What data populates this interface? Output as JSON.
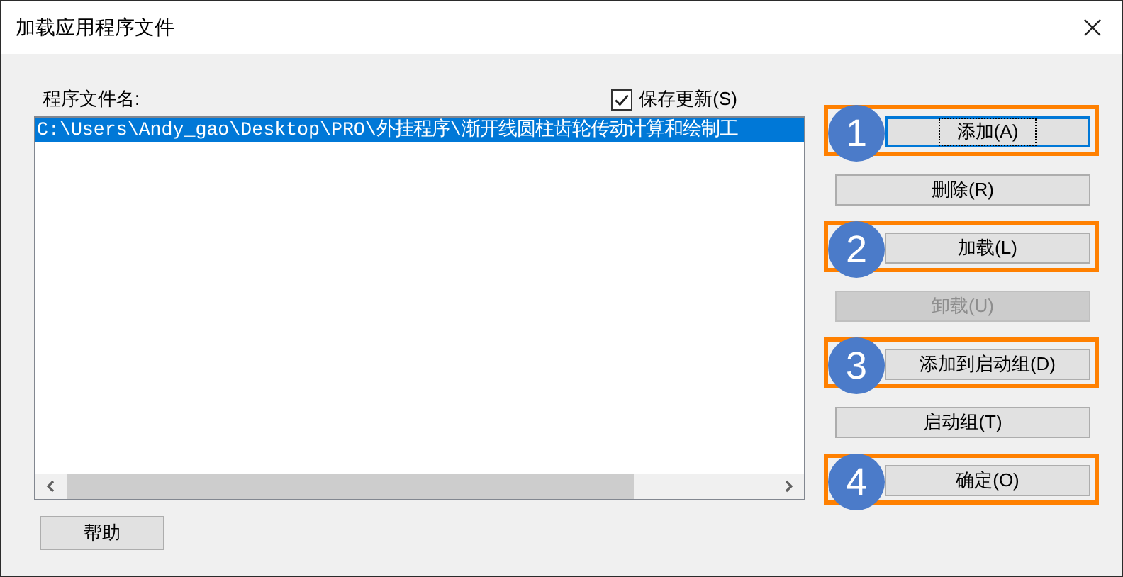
{
  "window": {
    "title": "加载应用程序文件"
  },
  "file_list": {
    "label": "程序文件名:",
    "items": [
      {
        "text": "C:\\Users\\Andy_gao\\Desktop\\PRO\\外挂程序\\渐开线圆柱齿轮传动计算和绘制工",
        "selected": true
      }
    ]
  },
  "save_updates": {
    "label": "保存更新(S)",
    "checked": true
  },
  "buttons": [
    {
      "label": "添加(A)",
      "disabled": false,
      "focused": true,
      "step": "1"
    },
    {
      "label": "删除(R)",
      "disabled": false,
      "focused": false
    },
    {
      "label": "加载(L)",
      "disabled": false,
      "focused": false,
      "step": "2"
    },
    {
      "label": "卸载(U)",
      "disabled": true,
      "focused": false
    },
    {
      "label": "添加到启动组(D)",
      "disabled": false,
      "focused": false,
      "step": "3"
    },
    {
      "label": "启动组(T)",
      "disabled": false,
      "focused": false
    },
    {
      "label": "确定(O)",
      "disabled": false,
      "focused": false,
      "step": "4"
    }
  ],
  "help_button": {
    "label": "帮助"
  }
}
